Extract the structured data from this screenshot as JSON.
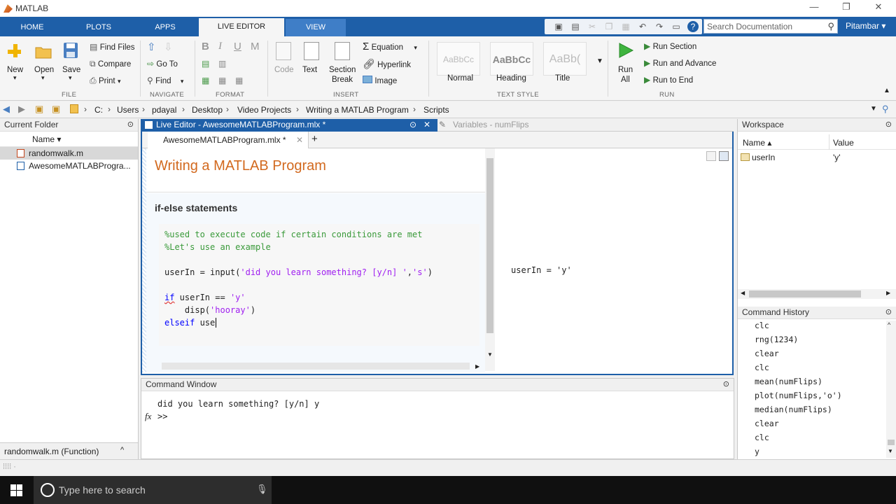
{
  "app": {
    "title": "MATLAB",
    "min": "—",
    "restore": "❐",
    "close": "✕"
  },
  "ribbon_tabs": [
    "HOME",
    "PLOTS",
    "APPS",
    "LIVE EDITOR",
    "VIEW"
  ],
  "search": {
    "placeholder": "Search Documentation"
  },
  "user": "Pitambar ▾",
  "ribbon": {
    "file": {
      "new": "New",
      "open": "Open",
      "save": "Save",
      "find_files": "Find Files",
      "compare": "Compare",
      "print": "Print",
      "section": "FILE"
    },
    "navigate": {
      "goto": "Go To",
      "find": "Find",
      "section": "NAVIGATE"
    },
    "format": {
      "b": "B",
      "i": "I",
      "u": "U",
      "m": "M",
      "section": "FORMAT"
    },
    "insert": {
      "code": "Code",
      "text": "Text",
      "section_break_1": "Section",
      "section_break_2": "Break",
      "equation": "Equation",
      "hyperlink": "Hyperlink",
      "image": "Image",
      "section": "INSERT"
    },
    "text_style": {
      "normal": "Normal",
      "heading": "Heading",
      "title": "Title",
      "sample": "AaBbCc",
      "sample_title": "AaBb(",
      "section": "TEXT STYLE"
    },
    "run": {
      "run_all_1": "Run",
      "run_all_2": "All",
      "run_section": "Run Section",
      "run_advance": "Run and Advance",
      "run_to_end": "Run to End",
      "section": "RUN"
    }
  },
  "breadcrumb": [
    "C:",
    "Users",
    "pdayal",
    "Desktop",
    "Video Projects",
    "Writing a MATLAB Program",
    "Scripts"
  ],
  "current_folder": {
    "title": "Current Folder",
    "col_name": "Name ▾",
    "files": [
      "randomwalk.m",
      "AwesomeMATLABProgra..."
    ],
    "detail": "randomwalk.m  (Function)"
  },
  "editor": {
    "header": "Live Editor - AwesomeMATLABProgram.mlx *",
    "vars_header": "Variables - numFlips",
    "tab": "AwesomeMATLABProgram.mlx *",
    "title": "Writing a MATLAB Program",
    "heading": "if-else statements",
    "comment1": "%used to execute code if certain conditions are met",
    "comment2": "%Let's use an example",
    "line_input_a": "userIn = input(",
    "line_input_str": "'did you learn something? [y/n] '",
    "line_input_b": ",",
    "line_input_str2": "'s'",
    "line_input_c": ")",
    "kw_if": "if",
    "line_if_rest": " userIn == ",
    "str_y": "'y'",
    "disp_a": "    disp(",
    "str_hooray": "'hooray'",
    "disp_b": ")",
    "kw_elseif": "elseif",
    "elseif_rest": " use",
    "output": "userIn = 'y'"
  },
  "command_window": {
    "title": "Command Window",
    "line1": "did you learn something? [y/n] y",
    "prompt": ">>",
    "fx": "fx"
  },
  "workspace": {
    "title": "Workspace",
    "col_name": "Name ▴",
    "col_value": "Value",
    "rows": [
      {
        "name": "userIn",
        "value": "'y'"
      }
    ]
  },
  "history": {
    "title": "Command History",
    "items": [
      "clc",
      "rng(1234)",
      "clear",
      "clc",
      "mean(numFlips)",
      "plot(numFlips,'o')",
      "median(numFlips)",
      "clear",
      "clc",
      "y"
    ]
  },
  "taskbar": {
    "search_placeholder": "Type here to search"
  }
}
